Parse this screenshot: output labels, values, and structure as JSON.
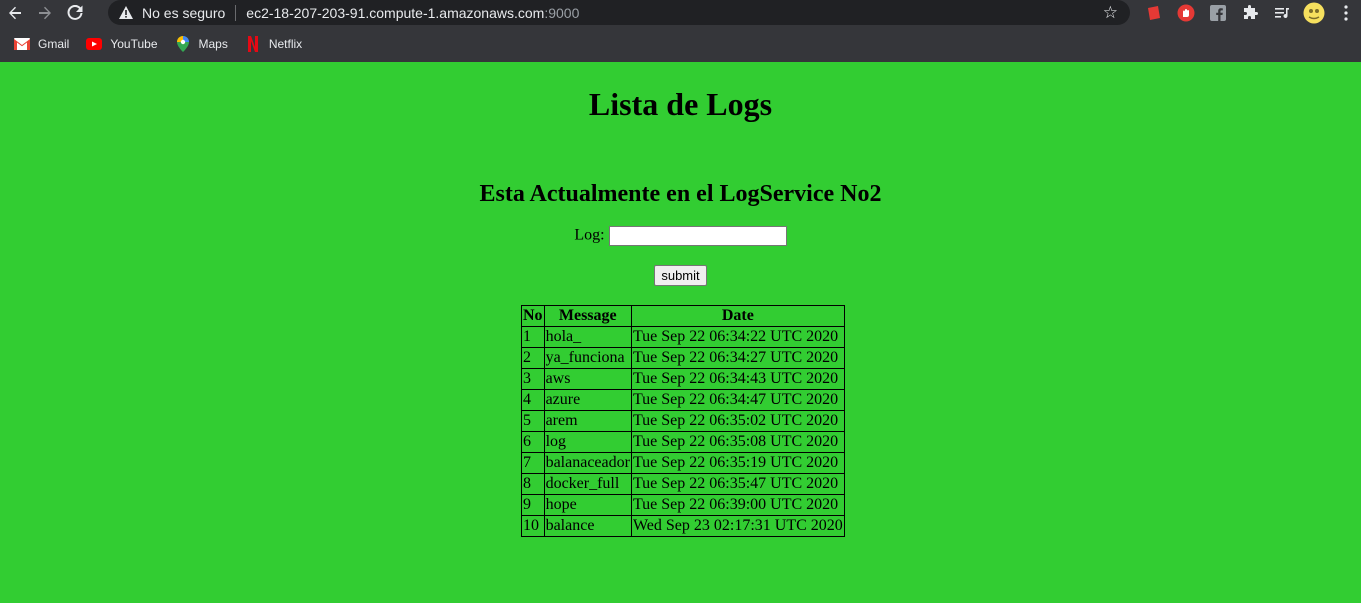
{
  "browser": {
    "security_label": "No es seguro",
    "url_host": "ec2-18-207-203-91.compute-1.amazonaws.com",
    "url_port": ":9000",
    "bookmarks": [
      {
        "label": "Gmail",
        "icon": "gmail-icon"
      },
      {
        "label": "YouTube",
        "icon": "youtube-icon"
      },
      {
        "label": "Maps",
        "icon": "maps-icon"
      },
      {
        "label": "Netflix",
        "icon": "netflix-icon"
      }
    ]
  },
  "page": {
    "title": "Lista de Logs",
    "subtitle": "Esta Actualmente en el LogService No2",
    "log_label": "Log:",
    "log_value": "",
    "submit_label": "submit",
    "background_color": "#32cd32",
    "table": {
      "headers": [
        "No",
        "Message",
        "Date"
      ],
      "rows": [
        [
          "1",
          "hola_",
          "Tue Sep 22 06:34:22 UTC 2020"
        ],
        [
          "2",
          "ya_funciona",
          "Tue Sep 22 06:34:27 UTC 2020"
        ],
        [
          "3",
          "aws",
          "Tue Sep 22 06:34:43 UTC 2020"
        ],
        [
          "4",
          "azure",
          "Tue Sep 22 06:34:47 UTC 2020"
        ],
        [
          "5",
          "arem",
          "Tue Sep 22 06:35:02 UTC 2020"
        ],
        [
          "6",
          "log",
          "Tue Sep 22 06:35:08 UTC 2020"
        ],
        [
          "7",
          "balanaceador",
          "Tue Sep 22 06:35:19 UTC 2020"
        ],
        [
          "8",
          "docker_full",
          "Tue Sep 22 06:35:47 UTC 2020"
        ],
        [
          "9",
          "hope",
          "Tue Sep 22 06:39:00 UTC 2020"
        ],
        [
          "10",
          "balance",
          "Wed Sep 23 02:17:31 UTC 2020"
        ]
      ]
    }
  }
}
